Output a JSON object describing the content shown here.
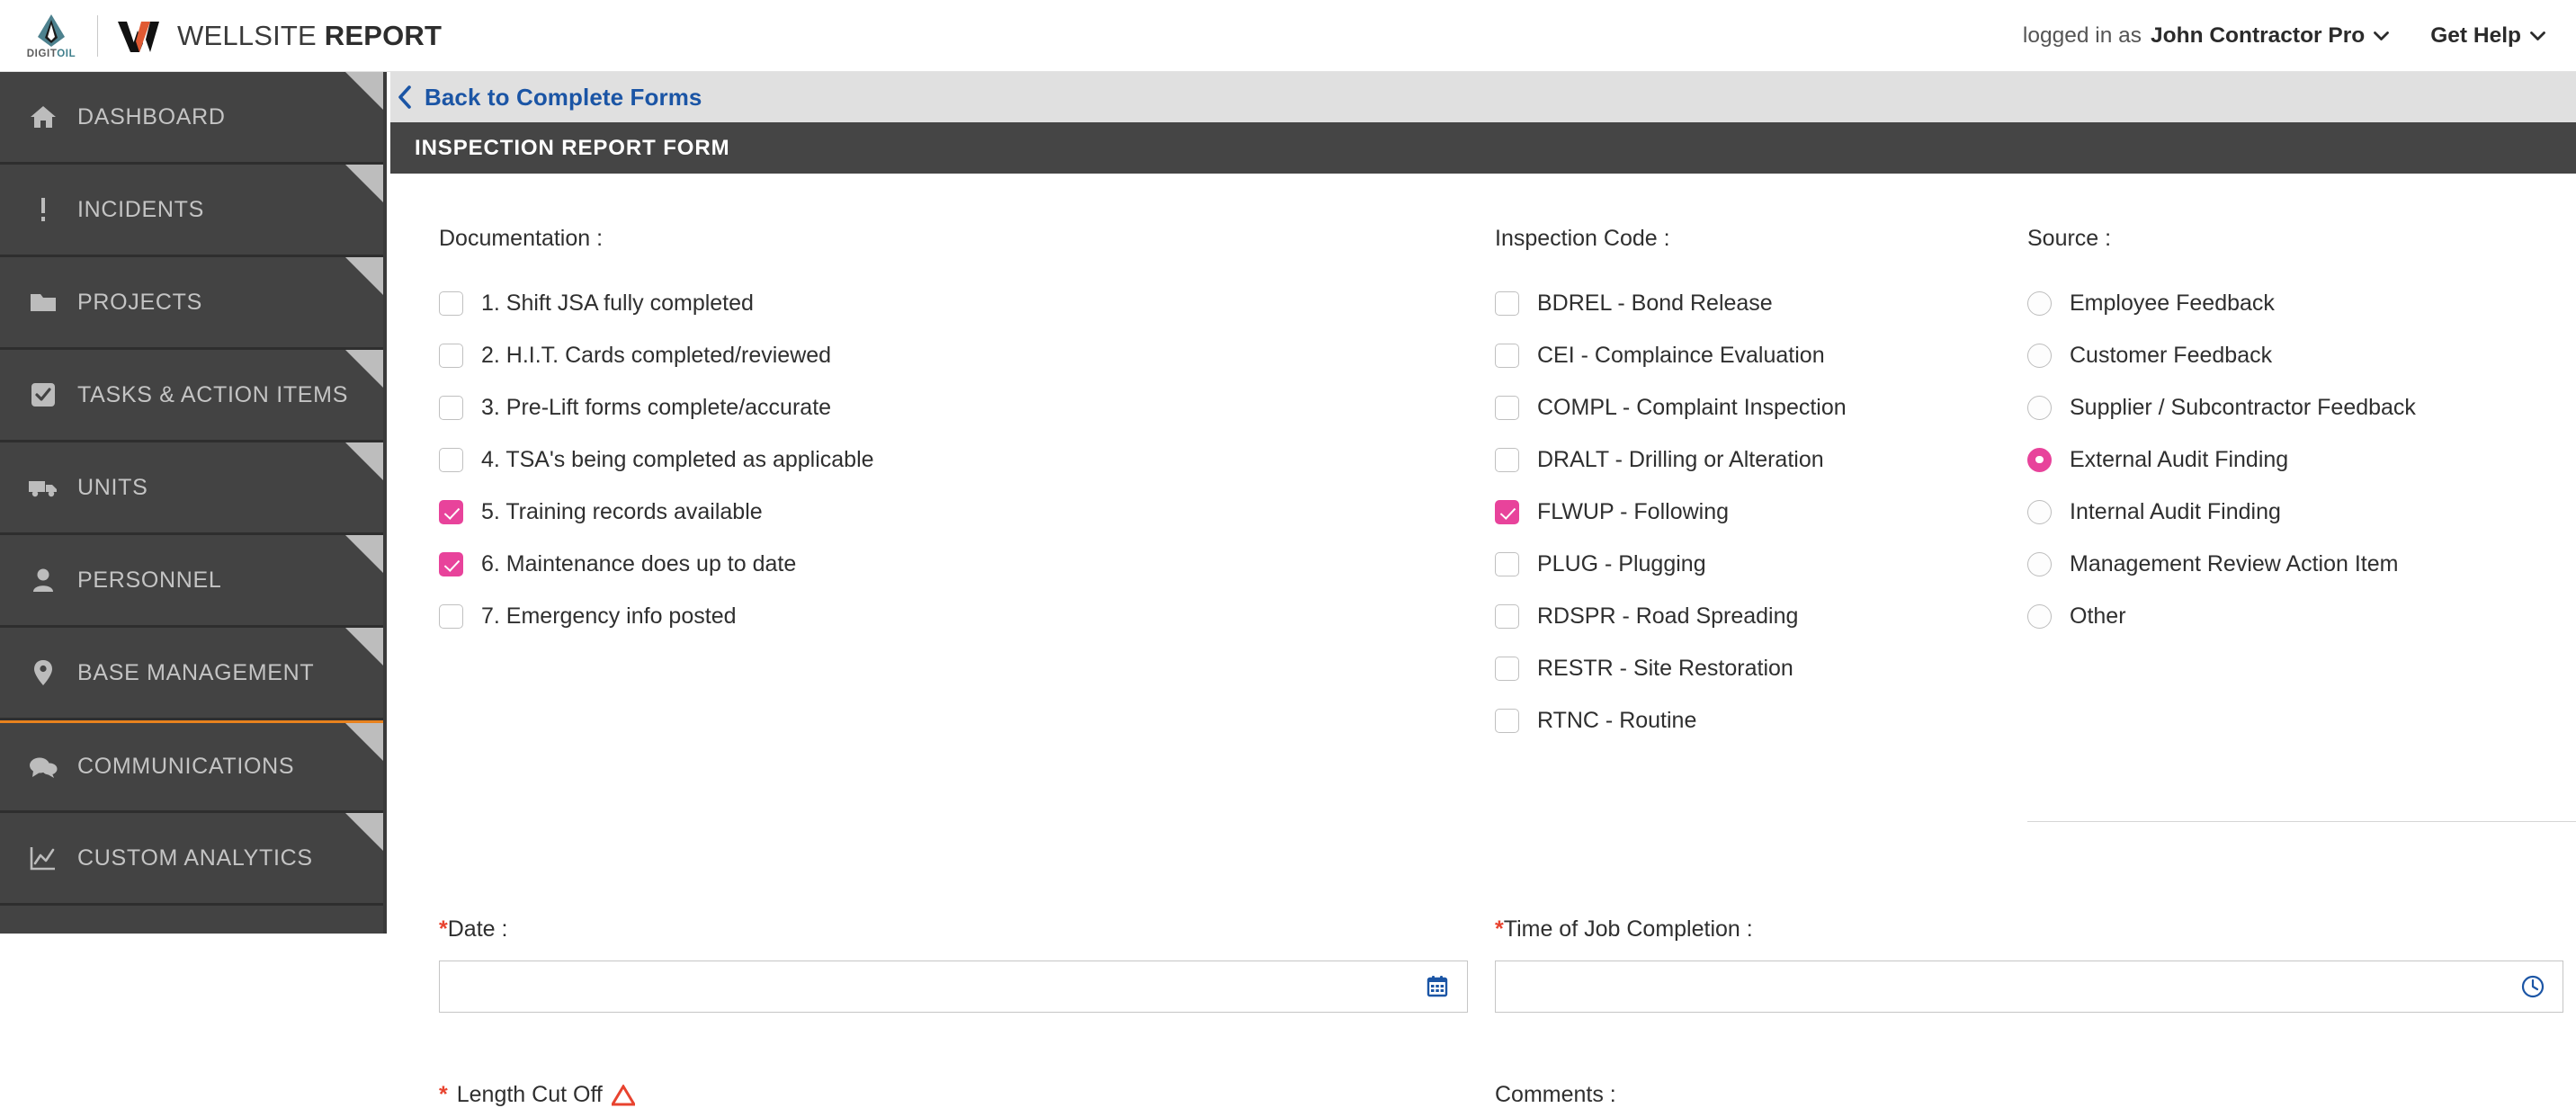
{
  "header": {
    "brand_logo_name": "digitoil-logo",
    "brand_word_1": "DIGIT",
    "brand_word_2": "OIL",
    "app_title_light": "WELLSITE ",
    "app_title_bold": "REPORT",
    "logged_in_prefix": "logged in as ",
    "user_name": "John Contractor Pro",
    "get_help": "Get Help",
    "colors": {
      "brand_teal": "#3f7f8c",
      "brand_orange": "#e05a33",
      "link_blue": "#1b55a5"
    }
  },
  "sidebar": {
    "items": [
      {
        "label": "DASHBOARD",
        "icon": "home-icon",
        "accent_top": false
      },
      {
        "label": "INCIDENTS",
        "icon": "alert-icon",
        "accent_top": false
      },
      {
        "label": "PROJECTS",
        "icon": "folder-icon",
        "accent_top": false
      },
      {
        "label": "TASKS & ACTION ITEMS",
        "icon": "checkbox-icon",
        "accent_top": false
      },
      {
        "label": "UNITS",
        "icon": "truck-icon",
        "accent_top": false
      },
      {
        "label": "PERSONNEL",
        "icon": "person-icon",
        "accent_top": false
      },
      {
        "label": "BASE MANAGEMENT",
        "icon": "map-pin-icon",
        "accent_top": false
      },
      {
        "label": "COMMUNICATIONS",
        "icon": "chat-icon",
        "accent_top": true
      },
      {
        "label": "CUSTOM ANALYTICS",
        "icon": "chart-icon",
        "accent_top": false
      }
    ]
  },
  "main": {
    "back_link": "Back to Complete Forms",
    "form_title": "INSPECTION REPORT FORM"
  },
  "documentation": {
    "label": "Documentation :",
    "options": [
      {
        "label": "1. Shift JSA fully completed",
        "checked": false
      },
      {
        "label": "2. H.I.T. Cards completed/reviewed",
        "checked": false
      },
      {
        "label": "3. Pre-Lift forms complete/accurate",
        "checked": false
      },
      {
        "label": "4. TSA's being completed as applicable",
        "checked": false
      },
      {
        "label": "5. Training records available",
        "checked": true
      },
      {
        "label": "6. Maintenance does up to date",
        "checked": true
      },
      {
        "label": "7. Emergency info posted",
        "checked": false
      }
    ]
  },
  "inspection_code": {
    "label": "Inspection Code :",
    "options": [
      {
        "label": "BDREL - Bond Release",
        "checked": false
      },
      {
        "label": "CEI - Complaince Evaluation",
        "checked": false
      },
      {
        "label": "COMPL - Complaint Inspection",
        "checked": false
      },
      {
        "label": "DRALT - Drilling or Alteration",
        "checked": false
      },
      {
        "label": "FLWUP - Following",
        "checked": true
      },
      {
        "label": "PLUG - Plugging",
        "checked": false
      },
      {
        "label": "RDSPR - Road Spreading",
        "checked": false
      },
      {
        "label": "RESTR - Site Restoration",
        "checked": false
      },
      {
        "label": "RTNC - Routine",
        "checked": false
      }
    ]
  },
  "source": {
    "label": "Source :",
    "options": [
      {
        "label": "Employee Feedback",
        "selected": false
      },
      {
        "label": "Customer Feedback",
        "selected": false
      },
      {
        "label": "Supplier / Subcontractor Feedback",
        "selected": false
      },
      {
        "label": "External Audit Finding",
        "selected": true
      },
      {
        "label": "Internal Audit Finding",
        "selected": false
      },
      {
        "label": "Management Review Action Item",
        "selected": false
      },
      {
        "label": "Other",
        "selected": false
      }
    ],
    "add_button_name": "add-source-button"
  },
  "fields": {
    "date": {
      "required_mark": "*",
      "label": "Date :",
      "value": "",
      "placeholder": "",
      "icon": "calendar-icon"
    },
    "time": {
      "required_mark": "*",
      "label": "Time of Job Completion :",
      "value": "",
      "placeholder": "",
      "icon": "clock-icon"
    }
  },
  "bottom_partial": {
    "left_required_mark": "*",
    "left_label": "Length Cut Off",
    "right_label": "Comments :"
  },
  "theme": {
    "accent_pink": "#e8439b",
    "accent_orange": "#e8821e",
    "required_red": "#e8432f",
    "sidebar_bg": "#434343",
    "form_header_bg": "#454545"
  }
}
